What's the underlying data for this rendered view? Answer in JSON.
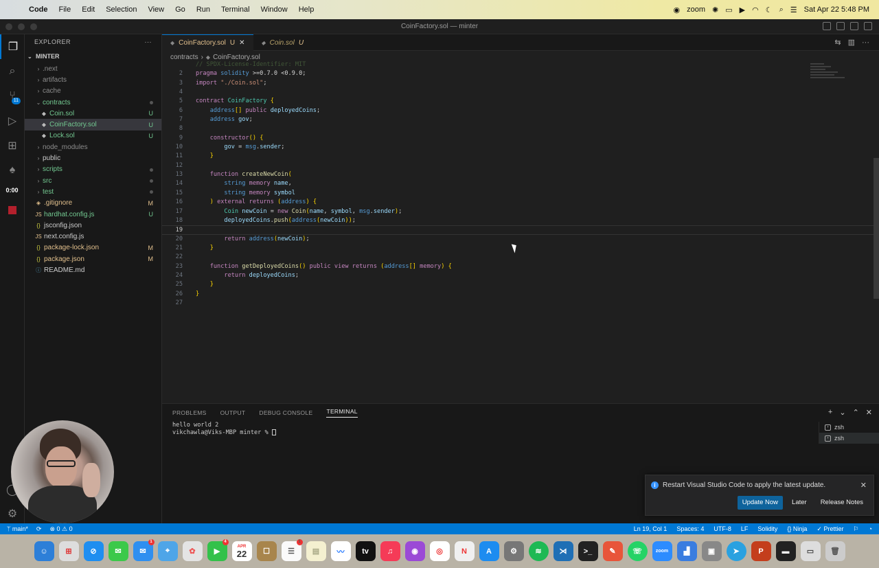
{
  "menubar": {
    "apple": "",
    "items": [
      "Code",
      "File",
      "Edit",
      "Selection",
      "View",
      "Go",
      "Run",
      "Terminal",
      "Window",
      "Help"
    ],
    "zoom": "zoom",
    "clock": "Sat Apr 22  5:48 PM"
  },
  "window": {
    "title": "CoinFactory.sol — minter"
  },
  "activity": {
    "scm_badge": "11",
    "timer": "0:00"
  },
  "explorer": {
    "header": "EXPLORER",
    "root": "MINTER",
    "items": [
      {
        "label": ".next",
        "kind": "folder",
        "status": ""
      },
      {
        "label": "artifacts",
        "kind": "folder",
        "status": ""
      },
      {
        "label": "cache",
        "kind": "folder",
        "status": ""
      },
      {
        "label": "contracts",
        "kind": "folder-open",
        "status": "dot"
      },
      {
        "label": "Coin.sol",
        "kind": "sol",
        "status": "U"
      },
      {
        "label": "CoinFactory.sol",
        "kind": "sol",
        "status": "U"
      },
      {
        "label": "Lock.sol",
        "kind": "sol",
        "status": "U"
      },
      {
        "label": "node_modules",
        "kind": "folder",
        "status": ""
      },
      {
        "label": "public",
        "kind": "folder",
        "status": ""
      },
      {
        "label": "scripts",
        "kind": "folder",
        "status": "dot"
      },
      {
        "label": "src",
        "kind": "folder",
        "status": "dot"
      },
      {
        "label": "test",
        "kind": "folder",
        "status": "dot"
      },
      {
        "label": ".gitignore",
        "kind": "git",
        "status": "M"
      },
      {
        "label": "hardhat.config.js",
        "kind": "js",
        "status": "U"
      },
      {
        "label": "jsconfig.json",
        "kind": "json",
        "status": ""
      },
      {
        "label": "next.config.js",
        "kind": "js",
        "status": ""
      },
      {
        "label": "package-lock.json",
        "kind": "json",
        "status": "M"
      },
      {
        "label": "package.json",
        "kind": "json",
        "status": "M"
      },
      {
        "label": "README.md",
        "kind": "md",
        "status": ""
      }
    ]
  },
  "tabs": [
    {
      "label": "CoinFactory.sol",
      "mod": "U",
      "active": true
    },
    {
      "label": "Coin.sol",
      "mod": "U",
      "active": false
    }
  ],
  "breadcrumb": {
    "folder": "contracts",
    "file": "CoinFactory.sol"
  },
  "code": {
    "current_line": 19,
    "lines": [
      {
        "n": "",
        "t": "// SPDX-License-Identifier: MIT"
      },
      {
        "n": "2",
        "t": "pragma solidity >=0.7.0 <0.9.0;"
      },
      {
        "n": "3",
        "t": "import \"./Coin.sol\";"
      },
      {
        "n": "4",
        "t": ""
      },
      {
        "n": "5",
        "t": "contract CoinFactory {"
      },
      {
        "n": "6",
        "t": "    address[] public deployedCoins;"
      },
      {
        "n": "7",
        "t": "    address gov;"
      },
      {
        "n": "8",
        "t": ""
      },
      {
        "n": "9",
        "t": "    constructor() {"
      },
      {
        "n": "10",
        "t": "        gov = msg.sender;"
      },
      {
        "n": "11",
        "t": "    }"
      },
      {
        "n": "12",
        "t": ""
      },
      {
        "n": "13",
        "t": "    function createNewCoin("
      },
      {
        "n": "14",
        "t": "        string memory name,"
      },
      {
        "n": "15",
        "t": "        string memory symbol"
      },
      {
        "n": "16",
        "t": "    ) external returns (address) {"
      },
      {
        "n": "17",
        "t": "        Coin newCoin = new Coin(name, symbol, msg.sender);"
      },
      {
        "n": "18",
        "t": "        deployedCoins.push(address(newCoin));"
      },
      {
        "n": "19",
        "t": ""
      },
      {
        "n": "20",
        "t": "        return address(newCoin);"
      },
      {
        "n": "21",
        "t": "    }"
      },
      {
        "n": "22",
        "t": ""
      },
      {
        "n": "23",
        "t": "    function getDeployedCoins() public view returns (address[] memory) {"
      },
      {
        "n": "24",
        "t": "        return deployedCoins;"
      },
      {
        "n": "25",
        "t": "    }"
      },
      {
        "n": "26",
        "t": "}"
      },
      {
        "n": "27",
        "t": ""
      }
    ]
  },
  "panel": {
    "tabs": [
      "PROBLEMS",
      "OUTPUT",
      "DEBUG CONSOLE",
      "TERMINAL"
    ],
    "active": "TERMINAL",
    "terminal_lines": [
      "hello world 2",
      "vikchawla@Viks-MBP minter % "
    ],
    "shells": [
      "zsh",
      "zsh"
    ]
  },
  "notification": {
    "message": "Restart Visual Studio Code to apply the latest update.",
    "buttons": [
      "Update Now",
      "Later",
      "Release Notes"
    ]
  },
  "statusbar": {
    "branch": "main*",
    "problems": "⊗ 0 ⚠ 0",
    "position": "Ln 19, Col 1",
    "spaces": "Spaces: 4",
    "encoding": "UTF-8",
    "eol": "LF",
    "language": "Solidity",
    "ninja": "Ninja",
    "prettier": "Prettier"
  },
  "dock": {
    "calendar_month": "APR",
    "calendar_day": "22",
    "mail_badge": "1",
    "facetime_badge": "4",
    "reminders_badge": "1",
    "tv_label": "tv",
    "zoom_label": "zoom"
  },
  "colors": {
    "accent": "#0078d4",
    "statusbar": "#0078d4",
    "editor_bg": "#1f1f1f",
    "sidebar_bg": "#181818"
  }
}
